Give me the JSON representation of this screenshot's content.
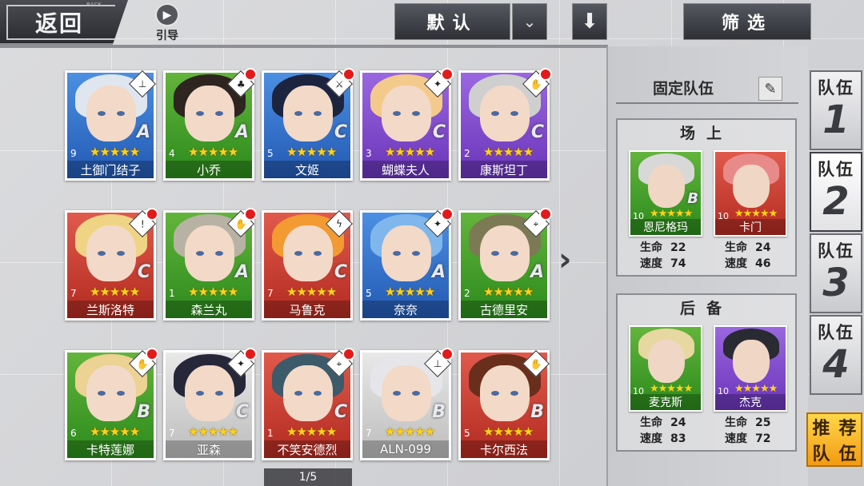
{
  "top_bar": {
    "back_label": "返回",
    "back_sub": "BACK",
    "guide_label": "引导",
    "sort_label": "默认",
    "filter_label": "筛选"
  },
  "roster": [
    {
      "name": "土御门结子",
      "level": "9",
      "rank": "A",
      "color": "blue",
      "role_icon": "⊥",
      "dot": false,
      "hair": "#dfe6f0"
    },
    {
      "name": "小乔",
      "level": "4",
      "rank": "A",
      "color": "green",
      "role_icon": "♣",
      "dot": true,
      "hair": "#2e2520"
    },
    {
      "name": "文姬",
      "level": "5",
      "rank": "C",
      "color": "blue",
      "role_icon": "⚔",
      "dot": true,
      "hair": "#1d2440"
    },
    {
      "name": "蝴蝶夫人",
      "level": "3",
      "rank": "C",
      "color": "purple",
      "role_icon": "✦",
      "dot": true,
      "hair": "#f4c98c"
    },
    {
      "name": "康斯坦丁",
      "level": "2",
      "rank": "C",
      "color": "purple",
      "role_icon": "✋",
      "dot": true,
      "hair": "#cfcfcf"
    },
    {
      "name": "兰斯洛特",
      "level": "7",
      "rank": "C",
      "color": "red",
      "role_icon": "!",
      "dot": true,
      "hair": "#f0d486"
    },
    {
      "name": "森兰丸",
      "level": "1",
      "rank": "A",
      "color": "green",
      "role_icon": "✋",
      "dot": true,
      "hair": "#b8b2a4"
    },
    {
      "name": "马鲁克",
      "level": "7",
      "rank": "C",
      "color": "red",
      "role_icon": "ϟ",
      "dot": false,
      "hair": "#f39a32"
    },
    {
      "name": "奈奈",
      "level": "5",
      "rank": "A",
      "color": "blue",
      "role_icon": "✦",
      "dot": true,
      "hair": "#7fb7ec"
    },
    {
      "name": "古德里安",
      "level": "2",
      "rank": "A",
      "color": "green",
      "role_icon": "⌖",
      "dot": true,
      "hair": "#7c7a55"
    },
    {
      "name": "卡特莲娜",
      "level": "6",
      "rank": "B",
      "color": "green",
      "role_icon": "✋",
      "dot": true,
      "hair": "#ecd293"
    },
    {
      "name": "亚森",
      "level": "7",
      "rank": "C",
      "color": "white",
      "role_icon": "✦",
      "dot": true,
      "hair": "#26283a"
    },
    {
      "name": "不笑安德烈",
      "level": "1",
      "rank": "C",
      "color": "red",
      "role_icon": "⌖",
      "dot": true,
      "hair": "#3c5a6a"
    },
    {
      "name": "ALN-099",
      "level": "7",
      "rank": "B",
      "color": "white",
      "role_icon": "⊥",
      "dot": true,
      "hair": "#e6e6ea"
    },
    {
      "name": "卡尔西法",
      "level": "5",
      "rank": "B",
      "color": "red",
      "role_icon": "✋",
      "dot": false,
      "hair": "#6a2f1c"
    }
  ],
  "pager": "1/5",
  "panel": {
    "fixed_team_label": "固定队伍",
    "front_title": "场上",
    "back_title": "后备",
    "front": [
      {
        "name": "恩尼格玛",
        "level": "10",
        "rank": "B",
        "color": "green",
        "hair": "#d8d8d8",
        "hp_label": "生命",
        "hp": "22",
        "spd_label": "速度",
        "spd": "74"
      },
      {
        "name": "卡门",
        "level": "10",
        "rank": "",
        "color": "red",
        "hair": "#e98a8a",
        "hp_label": "生命",
        "hp": "24",
        "spd_label": "速度",
        "spd": "46"
      }
    ],
    "back": [
      {
        "name": "麦克斯",
        "level": "10",
        "rank": "",
        "color": "green",
        "hair": "#e6d8a0",
        "hp_label": "生命",
        "hp": "24",
        "spd_label": "速度",
        "spd": "83"
      },
      {
        "name": "杰克",
        "level": "10",
        "rank": "",
        "color": "purple",
        "hair": "#2a2a33",
        "hp_label": "生命",
        "hp": "25",
        "spd_label": "速度",
        "spd": "72"
      }
    ]
  },
  "teams": [
    {
      "label": "队伍",
      "num": "1"
    },
    {
      "label": "队伍",
      "num": "2"
    },
    {
      "label": "队伍",
      "num": "3"
    },
    {
      "label": "队伍",
      "num": "4"
    }
  ],
  "recommend": [
    "推",
    "荐",
    "队",
    "伍"
  ]
}
